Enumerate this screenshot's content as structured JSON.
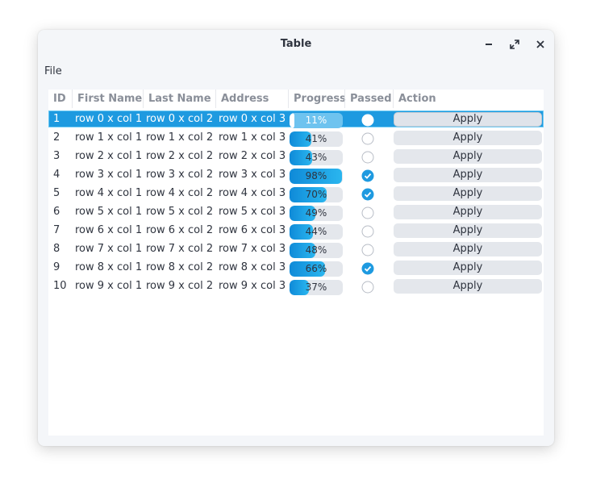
{
  "window": {
    "title": "Table"
  },
  "menubar": {
    "items": [
      "File"
    ]
  },
  "table": {
    "columns": [
      "ID",
      "First Name",
      "Last Name",
      "Address",
      "Progress",
      "Passed",
      "Action"
    ],
    "selected_row": 0,
    "rows": [
      {
        "id": "1",
        "first": "row 0 x col 1",
        "last": "row 0 x col 2",
        "address": "row 0 x col 3",
        "progress": 11,
        "progress_label": "11%",
        "passed": false,
        "action": "Apply"
      },
      {
        "id": "2",
        "first": "row 1 x col 1",
        "last": "row 1 x col 2",
        "address": "row 1 x col 3",
        "progress": 41,
        "progress_label": "41%",
        "passed": false,
        "action": "Apply"
      },
      {
        "id": "3",
        "first": "row 2 x col 1",
        "last": "row 2 x col 2",
        "address": "row 2 x col 3",
        "progress": 43,
        "progress_label": "43%",
        "passed": false,
        "action": "Apply"
      },
      {
        "id": "4",
        "first": "row 3 x col 1",
        "last": "row 3 x col 2",
        "address": "row 3 x col 3",
        "progress": 98,
        "progress_label": "98%",
        "passed": true,
        "action": "Apply"
      },
      {
        "id": "5",
        "first": "row 4 x col 1",
        "last": "row 4 x col 2",
        "address": "row 4 x col 3",
        "progress": 70,
        "progress_label": "70%",
        "passed": true,
        "action": "Apply"
      },
      {
        "id": "6",
        "first": "row 5 x col 1",
        "last": "row 5 x col 2",
        "address": "row 5 x col 3",
        "progress": 49,
        "progress_label": "49%",
        "passed": false,
        "action": "Apply"
      },
      {
        "id": "7",
        "first": "row 6 x col 1",
        "last": "row 6 x col 2",
        "address": "row 6 x col 3",
        "progress": 44,
        "progress_label": "44%",
        "passed": false,
        "action": "Apply"
      },
      {
        "id": "8",
        "first": "row 7 x col 1",
        "last": "row 7 x col 2",
        "address": "row 7 x col 3",
        "progress": 48,
        "progress_label": "48%",
        "passed": false,
        "action": "Apply"
      },
      {
        "id": "9",
        "first": "row 8 x col 1",
        "last": "row 8 x col 2",
        "address": "row 8 x col 3",
        "progress": 66,
        "progress_label": "66%",
        "passed": true,
        "action": "Apply"
      },
      {
        "id": "10",
        "first": "row 9 x col 1",
        "last": "row 9 x col 2",
        "address": "row 9 x col 3",
        "progress": 37,
        "progress_label": "37%",
        "passed": false,
        "action": "Apply"
      }
    ]
  },
  "colors": {
    "accent": "#1e9ae0",
    "check": "#1e9ae0",
    "button_bg": "#e4e7ec"
  },
  "icons": {
    "minimize": "minimize-icon",
    "maximize": "maximize-icon",
    "close": "close-icon"
  }
}
